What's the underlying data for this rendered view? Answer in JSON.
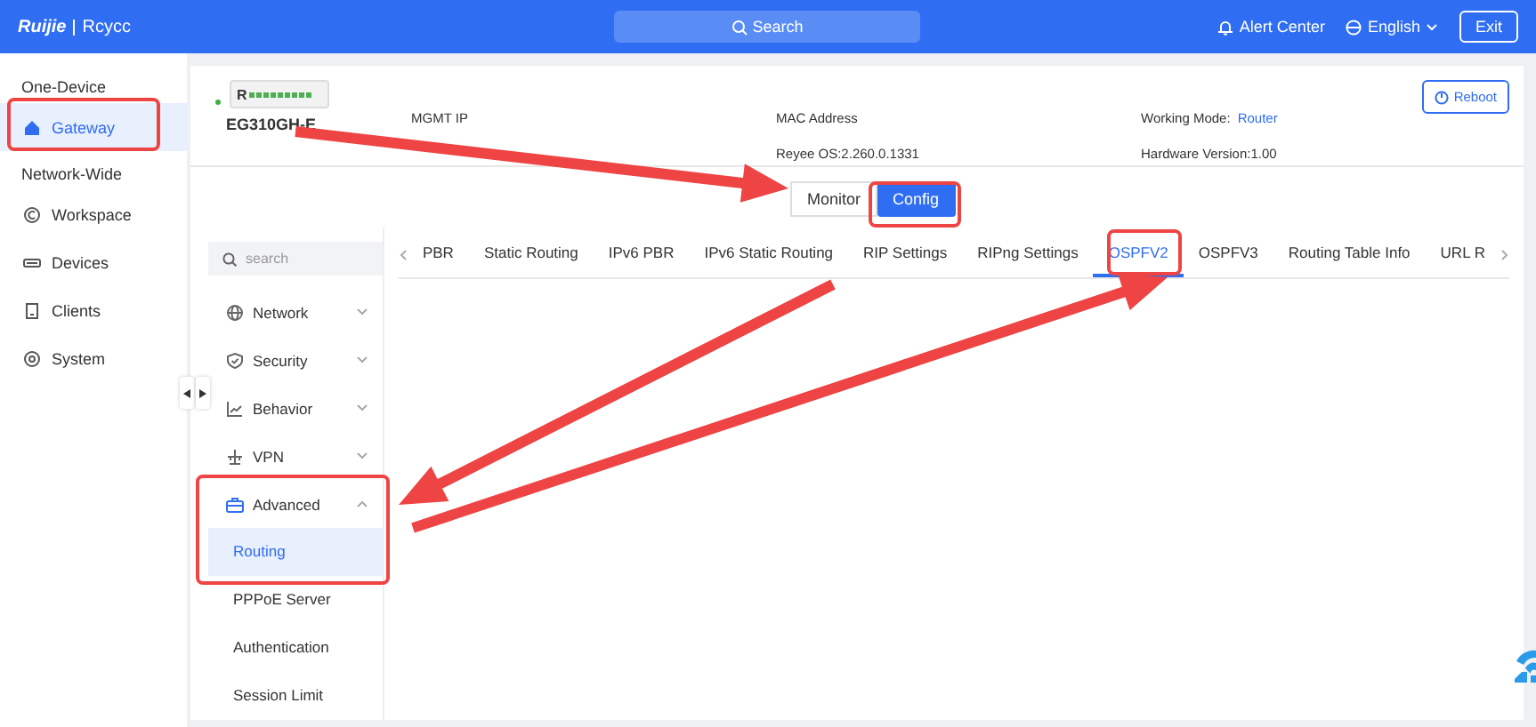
{
  "header": {
    "brand": "Ruijie",
    "product": "Rcycc",
    "search": {
      "placeholder": "Search"
    },
    "alert": "Alert Center",
    "language": "English",
    "exit": "Exit"
  },
  "sidebar": {
    "sections": [
      {
        "title": "One-Device",
        "items": [
          {
            "label": "Gateway",
            "selected": true
          }
        ]
      },
      {
        "title": "Network-Wide",
        "items": [
          {
            "label": "Workspace",
            "selected": false
          },
          {
            "label": "Devices",
            "selected": false
          },
          {
            "label": "Clients",
            "selected": false
          },
          {
            "label": "System",
            "selected": false
          }
        ]
      }
    ]
  },
  "device": {
    "online": true,
    "device_label": "R",
    "model": "EG310GH-E",
    "mgmt_ip_label": "MGMT IP",
    "mac_label": "MAC Address",
    "os": "Reyee OS:2.260.0.1331",
    "working_mode_label": "Working Mode:",
    "working_mode": "Router",
    "hardware": "Hardware Version:1.00",
    "reboot": "Reboot"
  },
  "mode_tabs": [
    {
      "label": "Monitor",
      "selected": false
    },
    {
      "label": "Config",
      "selected": true
    }
  ],
  "menu": {
    "search": {
      "placeholder": "search"
    },
    "items": [
      {
        "label": "Network",
        "expanded": false
      },
      {
        "label": "Security",
        "expanded": false
      },
      {
        "label": "Behavior",
        "expanded": false
      },
      {
        "label": "VPN",
        "expanded": false
      },
      {
        "label": "Advanced",
        "expanded": true,
        "children": [
          {
            "label": "Routing",
            "selected": true
          },
          {
            "label": "PPPoE Server",
            "selected": false
          },
          {
            "label": "Authentication",
            "selected": false
          },
          {
            "label": "Session Limit",
            "selected": false
          }
        ]
      }
    ]
  },
  "tabs": [
    {
      "label": "PBR",
      "selected": false
    },
    {
      "label": "Static Routing",
      "selected": false
    },
    {
      "label": "IPv6 PBR",
      "selected": false
    },
    {
      "label": "IPv6 Static Routing",
      "selected": false
    },
    {
      "label": "RIP Settings",
      "selected": false
    },
    {
      "label": "RIPng Settings",
      "selected": false
    },
    {
      "label": "OSPFV2",
      "selected": true
    },
    {
      "label": "OSPFV3",
      "selected": false
    },
    {
      "label": "Routing Table Info",
      "selected": false
    },
    {
      "label": "URL R",
      "selected": false
    }
  ]
}
